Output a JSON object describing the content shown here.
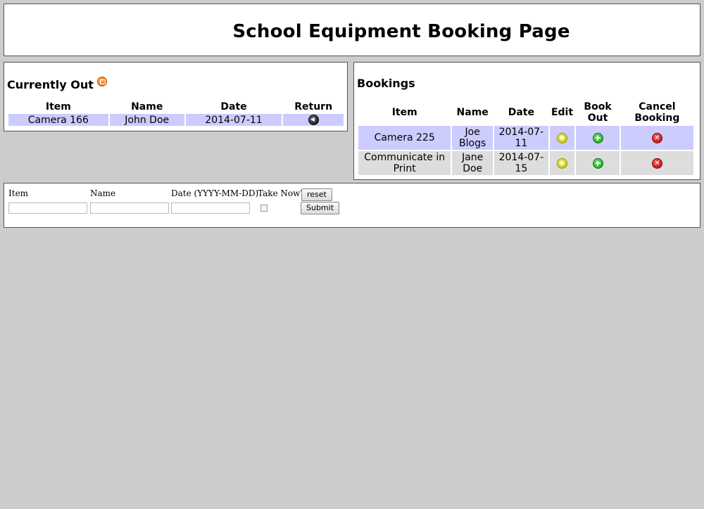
{
  "page": {
    "title": "School Equipment Booking Page"
  },
  "currently_out": {
    "title": "Currently Out",
    "rss_icon": "rss-feed-icon",
    "columns": [
      "Item",
      "Name",
      "Date",
      "Return"
    ],
    "rows": [
      {
        "item": "Camera 166",
        "name": "John Doe",
        "date": "2014-07-11",
        "return_icon": "return-arrow-icon"
      }
    ]
  },
  "bookings": {
    "title": "Bookings",
    "columns": [
      "Item",
      "Name",
      "Date",
      "Edit",
      "Book\nOut",
      "Cancel\nBooking"
    ],
    "rows": [
      {
        "item": "Camera 225",
        "name": "Joe Blogs",
        "date": "2014-07-11",
        "edit_icon": "edit-icon",
        "book_icon": "book-out-icon",
        "cancel_icon": "cancel-icon"
      },
      {
        "item": "Communicate in Print",
        "name": "Jane Doe",
        "date": "2014-07-15",
        "edit_icon": "edit-icon",
        "book_icon": "book-out-icon",
        "cancel_icon": "cancel-icon"
      }
    ]
  },
  "form": {
    "item_label": "Item",
    "name_label": "Name",
    "date_label": "Date (YYYY-MM-DD)",
    "take_now_label": "Take Now?",
    "reset_label": "reset",
    "submit_label": "Submit",
    "item_value": "",
    "name_value": "",
    "date_value": "",
    "take_now_checked": false
  },
  "colors": {
    "background": "#cccccc",
    "row_highlight": "#ccccff",
    "row_alt": "#dddddd"
  }
}
